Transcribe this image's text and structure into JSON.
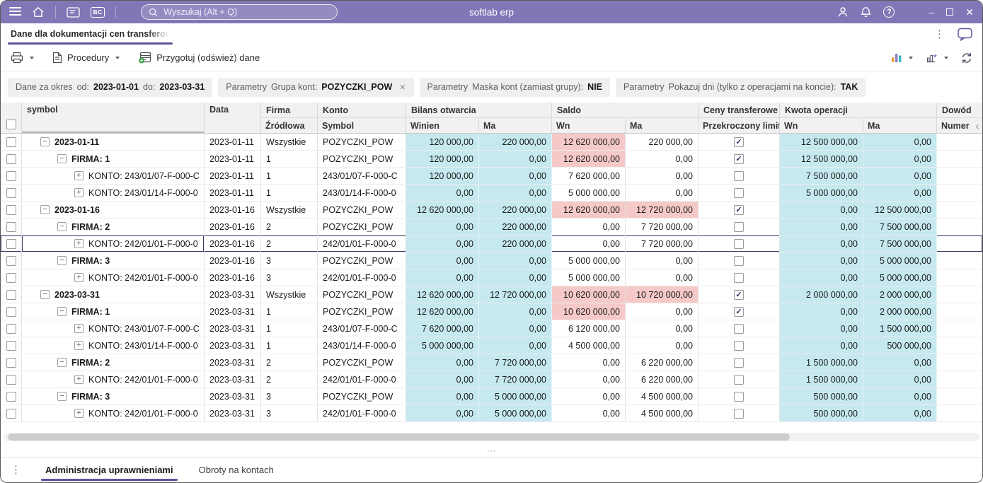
{
  "colors": {
    "titlebar_bg": "#8078b6",
    "accent": "#5f539e",
    "cyan_column_bg": "#c5e9ef",
    "alert_cell_bg": "#f6c9c9",
    "selected_outline": "#3c3c6e"
  },
  "icons": {
    "overflow_vertical": "⋮",
    "splitter_dots": "⋯",
    "panel_collapse": "‹",
    "chip_remove": "✕",
    "checkbox_check": "✓",
    "expander_collapse": "−",
    "expander_expand": "+",
    "help": "?",
    "window_minimize": "–",
    "window_close": "✕"
  },
  "titlebar": {
    "search_placeholder": "Wyszukaj (Alt + Q)",
    "app_title": "softlab erp",
    "bc_badge": "BC"
  },
  "tabbar": {
    "active_tab": "Dane dla dokumentacji cen transferow"
  },
  "toolbar": {
    "procedury": "Procedury",
    "prepare": "Przygotuj (odśwież) dane"
  },
  "params": {
    "period": {
      "prefix": "Dane za okres",
      "od_label": "od:",
      "od_value": "2023-01-01",
      "do_label": "do:",
      "do_value": "2023-03-31"
    },
    "chips": [
      {
        "prefix": "Parametry",
        "label": "Grupa kont:",
        "value": "POZYCZKI_POW",
        "removable": true
      },
      {
        "prefix": "Parametry",
        "label": "Maska kont (zamiast grupy):",
        "value": "NIE",
        "removable": false
      },
      {
        "prefix": "Parametry",
        "label": "Pokazuj dni (tylko z operacjami na koncie):",
        "value": "TAK",
        "removable": false
      }
    ]
  },
  "grid": {
    "header": {
      "symbol": "symbol",
      "data": "Data",
      "firma": "Firma",
      "firma_sub": "Źródłowa",
      "konto": "Konto",
      "konto_sub": "Symbol",
      "bilans": "Bilans otwarcia",
      "bilans_winien": "Winien",
      "bilans_ma": "Ma",
      "saldo": "Saldo",
      "saldo_wn": "Wn",
      "saldo_ma": "Ma",
      "ceny": "Ceny transferowe",
      "ceny_sub": "Przekroczony limit",
      "kwota": "Kwota operacji",
      "kwota_wn": "Wn",
      "kwota_ma": "Ma",
      "dowod": "Dowód",
      "dowod_sub": "Numer"
    },
    "rows": [
      {
        "level": 0,
        "expander": "minus",
        "symbol": "2023-01-11",
        "data": "2023-01-11",
        "firma": "Wszystkie",
        "konto": "POZYCZKI_POW",
        "bo_winien": "120 000,00",
        "bo_ma": "220 000,00",
        "saldo_wn": "12 620 000,00",
        "saldo_wn_alert": true,
        "saldo_ma": "220 000,00",
        "saldo_ma_alert": false,
        "limit_checked": true,
        "kwota_wn": "12 500 000,00",
        "kwota_ma": "0,00",
        "selected": false
      },
      {
        "level": 1,
        "expander": "minus",
        "symbol": "FIRMA: 1",
        "data": "2023-01-11",
        "firma": "1",
        "konto": "POZYCZKI_POW",
        "bo_winien": "120 000,00",
        "bo_ma": "0,00",
        "saldo_wn": "12 620 000,00",
        "saldo_wn_alert": true,
        "saldo_ma": "0,00",
        "saldo_ma_alert": false,
        "limit_checked": true,
        "kwota_wn": "12 500 000,00",
        "kwota_ma": "0,00",
        "selected": false
      },
      {
        "level": 2,
        "expander": "plus",
        "symbol": "KONTO: 243/01/07-F-000-C",
        "data": "2023-01-11",
        "firma": "1",
        "konto": "243/01/07-F-000-C",
        "bo_winien": "120 000,00",
        "bo_ma": "0,00",
        "saldo_wn": "7 620 000,00",
        "saldo_wn_alert": false,
        "saldo_ma": "0,00",
        "saldo_ma_alert": false,
        "limit_checked": false,
        "kwota_wn": "7 500 000,00",
        "kwota_ma": "0,00",
        "selected": false
      },
      {
        "level": 2,
        "expander": "plus",
        "symbol": "KONTO: 243/01/14-F-000-0",
        "data": "2023-01-11",
        "firma": "1",
        "konto": "243/01/14-F-000-0",
        "bo_winien": "0,00",
        "bo_ma": "0,00",
        "saldo_wn": "5 000 000,00",
        "saldo_wn_alert": false,
        "saldo_ma": "0,00",
        "saldo_ma_alert": false,
        "limit_checked": false,
        "kwota_wn": "5 000 000,00",
        "kwota_ma": "0,00",
        "selected": false
      },
      {
        "level": 0,
        "expander": "minus",
        "symbol": "2023-01-16",
        "data": "2023-01-16",
        "firma": "Wszystkie",
        "konto": "POZYCZKI_POW",
        "bo_winien": "12 620 000,00",
        "bo_ma": "220 000,00",
        "saldo_wn": "12 620 000,00",
        "saldo_wn_alert": true,
        "saldo_ma": "12 720 000,00",
        "saldo_ma_alert": true,
        "limit_checked": true,
        "kwota_wn": "0,00",
        "kwota_ma": "12 500 000,00",
        "selected": false
      },
      {
        "level": 1,
        "expander": "minus",
        "symbol": "FIRMA: 2",
        "data": "2023-01-16",
        "firma": "2",
        "konto": "POZYCZKI_POW",
        "bo_winien": "0,00",
        "bo_ma": "220 000,00",
        "saldo_wn": "0,00",
        "saldo_wn_alert": false,
        "saldo_ma": "7 720 000,00",
        "saldo_ma_alert": false,
        "limit_checked": false,
        "kwota_wn": "0,00",
        "kwota_ma": "7 500 000,00",
        "selected": false
      },
      {
        "level": 2,
        "expander": "plus",
        "symbol": "KONTO: 242/01/01-F-000-0",
        "data": "2023-01-16",
        "firma": "2",
        "konto": "242/01/01-F-000-0",
        "bo_winien": "0,00",
        "bo_ma": "220 000,00",
        "saldo_wn": "0,00",
        "saldo_wn_alert": false,
        "saldo_ma": "7 720 000,00",
        "saldo_ma_alert": false,
        "limit_checked": false,
        "kwota_wn": "0,00",
        "kwota_ma": "7 500 000,00",
        "selected": true
      },
      {
        "level": 1,
        "expander": "minus",
        "symbol": "FIRMA: 3",
        "data": "2023-01-16",
        "firma": "3",
        "konto": "POZYCZKI_POW",
        "bo_winien": "0,00",
        "bo_ma": "0,00",
        "saldo_wn": "5 000 000,00",
        "saldo_wn_alert": false,
        "saldo_ma": "0,00",
        "saldo_ma_alert": false,
        "limit_checked": false,
        "kwota_wn": "0,00",
        "kwota_ma": "5 000 000,00",
        "selected": false
      },
      {
        "level": 2,
        "expander": "plus",
        "symbol": "KONTO: 242/01/01-F-000-0",
        "data": "2023-01-16",
        "firma": "3",
        "konto": "242/01/01-F-000-0",
        "bo_winien": "0,00",
        "bo_ma": "0,00",
        "saldo_wn": "5 000 000,00",
        "saldo_wn_alert": false,
        "saldo_ma": "0,00",
        "saldo_ma_alert": false,
        "limit_checked": false,
        "kwota_wn": "0,00",
        "kwota_ma": "5 000 000,00",
        "selected": false
      },
      {
        "level": 0,
        "expander": "minus",
        "symbol": "2023-03-31",
        "data": "2023-03-31",
        "firma": "Wszystkie",
        "konto": "POZYCZKI_POW",
        "bo_winien": "12 620 000,00",
        "bo_ma": "12 720 000,00",
        "saldo_wn": "10 620 000,00",
        "saldo_wn_alert": true,
        "saldo_ma": "10 720 000,00",
        "saldo_ma_alert": true,
        "limit_checked": true,
        "kwota_wn": "2 000 000,00",
        "kwota_ma": "2 000 000,00",
        "selected": false
      },
      {
        "level": 1,
        "expander": "minus",
        "symbol": "FIRMA: 1",
        "data": "2023-03-31",
        "firma": "1",
        "konto": "POZYCZKI_POW",
        "bo_winien": "12 620 000,00",
        "bo_ma": "0,00",
        "saldo_wn": "10 620 000,00",
        "saldo_wn_alert": true,
        "saldo_ma": "0,00",
        "saldo_ma_alert": false,
        "limit_checked": true,
        "kwota_wn": "0,00",
        "kwota_ma": "2 000 000,00",
        "selected": false
      },
      {
        "level": 2,
        "expander": "plus",
        "symbol": "KONTO: 243/01/07-F-000-C",
        "data": "2023-03-31",
        "firma": "1",
        "konto": "243/01/07-F-000-C",
        "bo_winien": "7 620 000,00",
        "bo_ma": "0,00",
        "saldo_wn": "6 120 000,00",
        "saldo_wn_alert": false,
        "saldo_ma": "0,00",
        "saldo_ma_alert": false,
        "limit_checked": false,
        "kwota_wn": "0,00",
        "kwota_ma": "1 500 000,00",
        "selected": false
      },
      {
        "level": 2,
        "expander": "plus",
        "symbol": "KONTO: 243/01/14-F-000-0",
        "data": "2023-03-31",
        "firma": "1",
        "konto": "243/01/14-F-000-0",
        "bo_winien": "5 000 000,00",
        "bo_ma": "0,00",
        "saldo_wn": "4 500 000,00",
        "saldo_wn_alert": false,
        "saldo_ma": "0,00",
        "saldo_ma_alert": false,
        "limit_checked": false,
        "kwota_wn": "0,00",
        "kwota_ma": "500 000,00",
        "selected": false
      },
      {
        "level": 1,
        "expander": "minus",
        "symbol": "FIRMA: 2",
        "data": "2023-03-31",
        "firma": "2",
        "konto": "POZYCZKI_POW",
        "bo_winien": "0,00",
        "bo_ma": "7 720 000,00",
        "saldo_wn": "0,00",
        "saldo_wn_alert": false,
        "saldo_ma": "6 220 000,00",
        "saldo_ma_alert": false,
        "limit_checked": false,
        "kwota_wn": "1 500 000,00",
        "kwota_ma": "0,00",
        "selected": false
      },
      {
        "level": 2,
        "expander": "plus",
        "symbol": "KONTO: 242/01/01-F-000-0",
        "data": "2023-03-31",
        "firma": "2",
        "konto": "242/01/01-F-000-0",
        "bo_winien": "0,00",
        "bo_ma": "7 720 000,00",
        "saldo_wn": "0,00",
        "saldo_wn_alert": false,
        "saldo_ma": "6 220 000,00",
        "saldo_ma_alert": false,
        "limit_checked": false,
        "kwota_wn": "1 500 000,00",
        "kwota_ma": "0,00",
        "selected": false
      },
      {
        "level": 1,
        "expander": "minus",
        "symbol": "FIRMA: 3",
        "data": "2023-03-31",
        "firma": "3",
        "konto": "POZYCZKI_POW",
        "bo_winien": "0,00",
        "bo_ma": "5 000 000,00",
        "saldo_wn": "0,00",
        "saldo_wn_alert": false,
        "saldo_ma": "4 500 000,00",
        "saldo_ma_alert": false,
        "limit_checked": false,
        "kwota_wn": "500 000,00",
        "kwota_ma": "0,00",
        "selected": false
      },
      {
        "level": 2,
        "expander": "plus",
        "symbol": "KONTO: 242/01/01-F-000-0",
        "data": "2023-03-31",
        "firma": "3",
        "konto": "242/01/01-F-000-0",
        "bo_winien": "0,00",
        "bo_ma": "5 000 000,00",
        "saldo_wn": "0,00",
        "saldo_wn_alert": false,
        "saldo_ma": "4 500 000,00",
        "saldo_ma_alert": false,
        "limit_checked": false,
        "kwota_wn": "500 000,00",
        "kwota_ma": "0,00",
        "selected": false
      }
    ]
  },
  "bottom_tabs": [
    {
      "label": "Administracja uprawnieniami",
      "active": true
    },
    {
      "label": "Obroty na kontach",
      "active": false
    }
  ]
}
